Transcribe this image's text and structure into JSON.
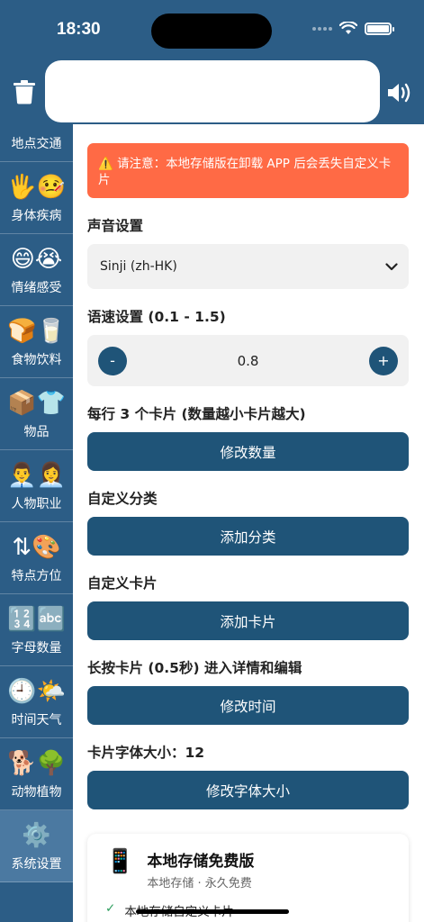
{
  "status": {
    "time": "18:30"
  },
  "colors": {
    "header": "#2c5d86",
    "button": "#1f5478",
    "warning": "#ff6a45",
    "active_sidebar": "#4b79a1"
  },
  "sidebar": {
    "items": [
      {
        "label": "地点交通",
        "icons": "🏫🚌"
      },
      {
        "label": "身体疾病",
        "icons": "🖐️🤒"
      },
      {
        "label": "情绪感受",
        "icons": "😄😭"
      },
      {
        "label": "食物饮料",
        "icons": "🍞🥛"
      },
      {
        "label": "物品",
        "icons": "📦👕"
      },
      {
        "label": "人物职业",
        "icons": "👨‍💼👩‍💼"
      },
      {
        "label": "特点方位",
        "icons": "⇅🎨"
      },
      {
        "label": "字母数量",
        "icons": "🔢🔤"
      },
      {
        "label": "时间天气",
        "icons": "🕘🌤️"
      },
      {
        "label": "动物植物",
        "icons": "🐕🌳"
      },
      {
        "label": "系统设置",
        "icons": "⚙️"
      }
    ]
  },
  "warning_text": "⚠️ 请注意：本地存储版在卸载 APP 后会丢失自定义卡片",
  "voice": {
    "label": "声音设置",
    "selected": "Sinji (zh-HK)"
  },
  "rate": {
    "label": "语速设置 (0.1 - 1.5)",
    "value": "0.8",
    "minus": "-",
    "plus": "+"
  },
  "per_row": {
    "label": "每行 3 个卡片 (数量越小卡片越大)",
    "button": "修改数量"
  },
  "custom_category": {
    "label": "自定义分类",
    "button": "添加分类"
  },
  "custom_card": {
    "label": "自定义卡片",
    "button": "添加卡片"
  },
  "long_press": {
    "label": "长按卡片 (0.5秒) 进入详情和编辑",
    "button": "修改时间"
  },
  "font_size": {
    "label": "卡片字体大小：12",
    "button": "修改字体大小"
  },
  "plan": {
    "icon": "📱",
    "title": "本地存储免费版",
    "subtitle": "本地存储 · 永久免费",
    "features": [
      "本地存储自定义卡片"
    ]
  }
}
